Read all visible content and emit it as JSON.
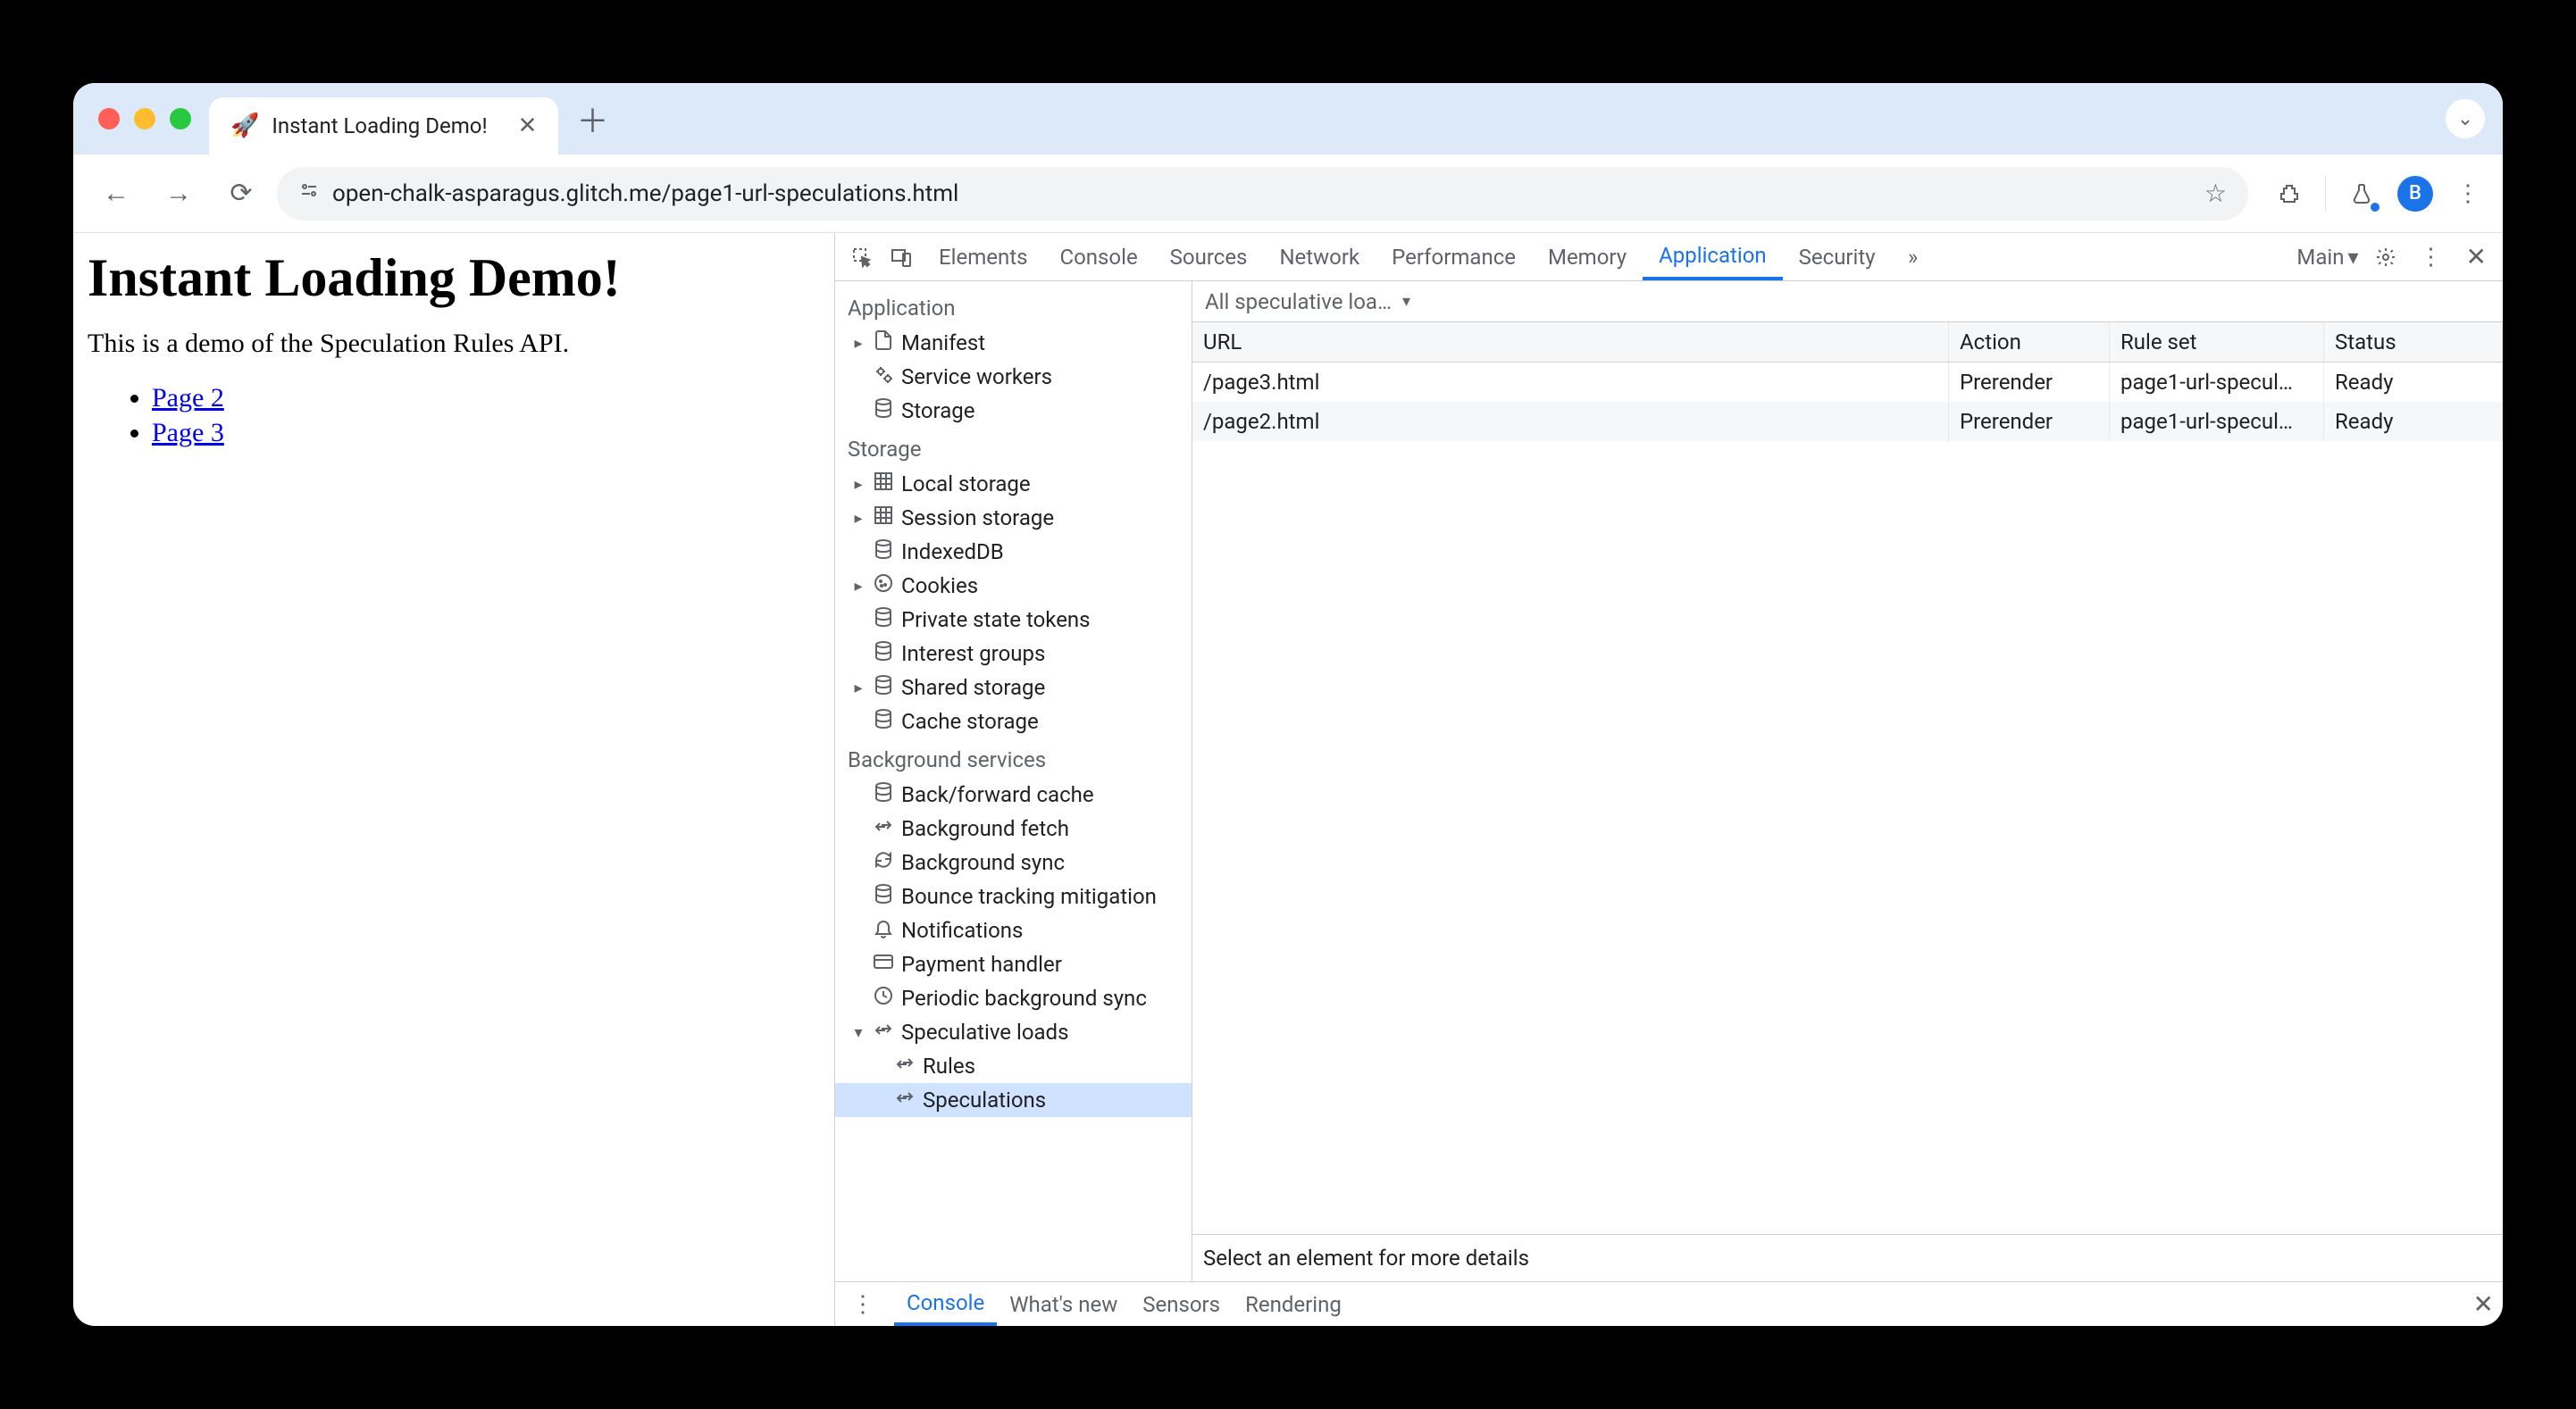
{
  "browser": {
    "tab_title": "Instant Loading Demo!",
    "url": "open-chalk-asparagus.glitch.me/page1-url-speculations.html",
    "favicon": "🚀",
    "avatar_letter": "B"
  },
  "page": {
    "heading": "Instant Loading Demo!",
    "intro": "This is a demo of the Speculation Rules API.",
    "links": [
      {
        "label": "Page 2"
      },
      {
        "label": "Page 3"
      }
    ]
  },
  "devtools": {
    "tabs": [
      "Elements",
      "Console",
      "Sources",
      "Network",
      "Performance",
      "Memory",
      "Application",
      "Security"
    ],
    "active_tab": "Application",
    "target_label": "Main",
    "sidebar": [
      {
        "kind": "section",
        "label": "Application"
      },
      {
        "kind": "item",
        "label": "Manifest",
        "icon": "file",
        "chev": "right",
        "indent": 0
      },
      {
        "kind": "item",
        "label": "Service workers",
        "icon": "gears",
        "indent": 0
      },
      {
        "kind": "item",
        "label": "Storage",
        "icon": "db",
        "indent": 0
      },
      {
        "kind": "section",
        "label": "Storage"
      },
      {
        "kind": "item",
        "label": "Local storage",
        "icon": "grid",
        "chev": "right",
        "indent": 0
      },
      {
        "kind": "item",
        "label": "Session storage",
        "icon": "grid",
        "chev": "right",
        "indent": 0
      },
      {
        "kind": "item",
        "label": "IndexedDB",
        "icon": "db",
        "indent": 0
      },
      {
        "kind": "item",
        "label": "Cookies",
        "icon": "cookie",
        "chev": "right",
        "indent": 0
      },
      {
        "kind": "item",
        "label": "Private state tokens",
        "icon": "db",
        "indent": 0
      },
      {
        "kind": "item",
        "label": "Interest groups",
        "icon": "db",
        "indent": 0
      },
      {
        "kind": "item",
        "label": "Shared storage",
        "icon": "db",
        "chev": "right",
        "indent": 0
      },
      {
        "kind": "item",
        "label": "Cache storage",
        "icon": "db",
        "indent": 0
      },
      {
        "kind": "section",
        "label": "Background services"
      },
      {
        "kind": "item",
        "label": "Back/forward cache",
        "icon": "db",
        "indent": 0
      },
      {
        "kind": "item",
        "label": "Background fetch",
        "icon": "updown",
        "indent": 0
      },
      {
        "kind": "item",
        "label": "Background sync",
        "icon": "sync",
        "indent": 0
      },
      {
        "kind": "item",
        "label": "Bounce tracking mitigation",
        "icon": "db",
        "indent": 0
      },
      {
        "kind": "item",
        "label": "Notifications",
        "icon": "bell",
        "indent": 0
      },
      {
        "kind": "item",
        "label": "Payment handler",
        "icon": "card",
        "indent": 0
      },
      {
        "kind": "item",
        "label": "Periodic background sync",
        "icon": "clock",
        "indent": 0
      },
      {
        "kind": "item",
        "label": "Speculative loads",
        "icon": "updown",
        "chev": "down",
        "indent": 0
      },
      {
        "kind": "item",
        "label": "Rules",
        "icon": "updown",
        "indent": 1
      },
      {
        "kind": "item",
        "label": "Speculations",
        "icon": "updown",
        "indent": 1,
        "selected": true
      }
    ],
    "filter_label": "All speculative loa…",
    "table": {
      "columns": [
        "URL",
        "Action",
        "Rule set",
        "Status"
      ],
      "rows": [
        {
          "url": "/page3.html",
          "action": "Prerender",
          "ruleset": "page1-url-specul…",
          "status": "Ready"
        },
        {
          "url": "/page2.html",
          "action": "Prerender",
          "ruleset": "page1-url-specul…",
          "status": "Ready"
        }
      ]
    },
    "detail_hint": "Select an element for more details",
    "drawer_tabs": [
      "Console",
      "What's new",
      "Sensors",
      "Rendering"
    ],
    "drawer_active": "Console"
  }
}
